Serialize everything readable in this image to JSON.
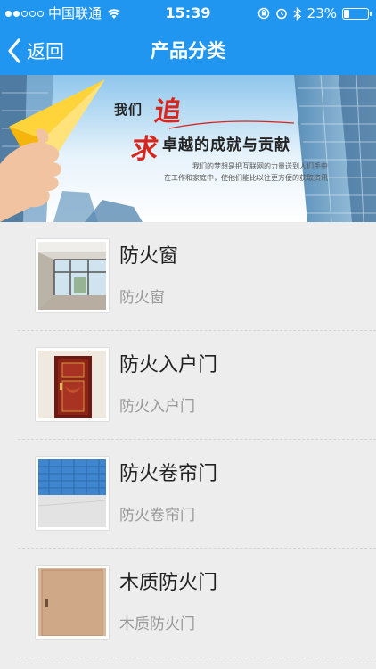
{
  "status_bar": {
    "carrier": "中国联通",
    "time": "15:39",
    "battery": "23%"
  },
  "navbar": {
    "back_label": "返回",
    "title": "产品分类"
  },
  "banner": {
    "line1_prefix": "我们",
    "line1_chase": "追",
    "line2_seek": "求",
    "line2_rest": "卓越的成就与贡献",
    "sub1": "我们的梦想是把互联网的力量送到人们手中",
    "sub2": "在工作和家庭中，使他们能比以往更方便的获取资讯"
  },
  "products": [
    {
      "title": "防火窗",
      "subtitle": "防火窗"
    },
    {
      "title": "防火入户门",
      "subtitle": "防火入户门"
    },
    {
      "title": "防火卷帘门",
      "subtitle": "防火卷帘门"
    },
    {
      "title": "木质防火门",
      "subtitle": "木质防火门"
    }
  ]
}
